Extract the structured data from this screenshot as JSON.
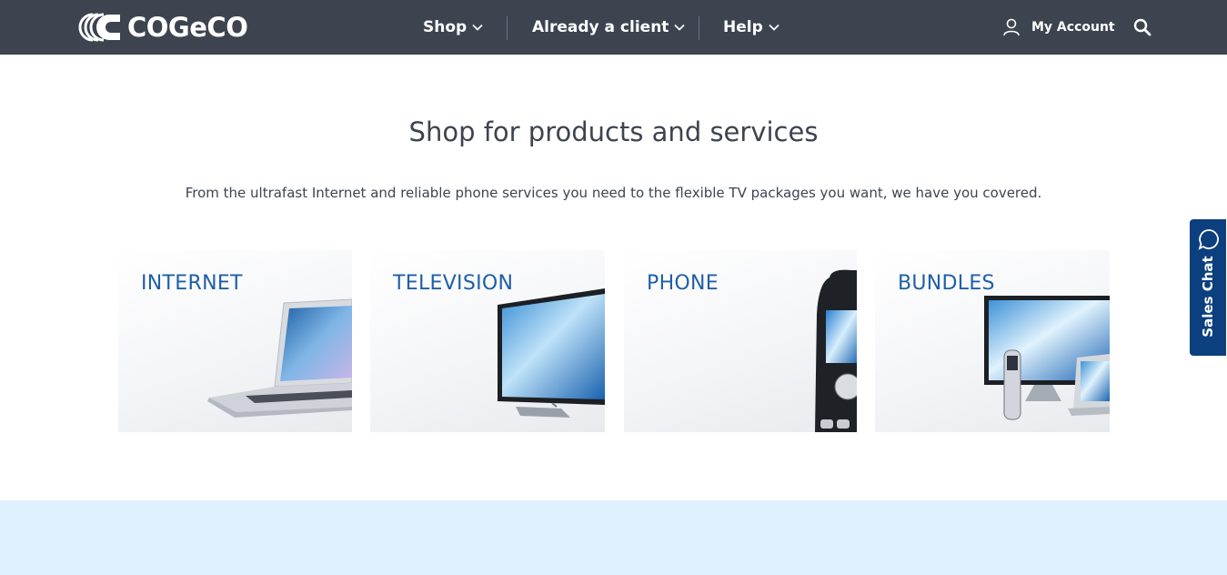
{
  "header": {
    "logo_text": "COGeCO",
    "nav": [
      {
        "label": "Shop"
      },
      {
        "label": "Already a client"
      },
      {
        "label": "Help"
      }
    ],
    "account_label": "My Account",
    "icons": {
      "user": "user-icon",
      "search": "search-icon",
      "chevron": "chevron-down-icon"
    }
  },
  "main": {
    "title": "Shop for products and services",
    "subtitle": "From the ultrafast Internet and reliable phone services you need to the flexible TV packages you want, we have you covered.",
    "cards": [
      {
        "label": "INTERNET"
      },
      {
        "label": "TELEVISION"
      },
      {
        "label": "PHONE"
      },
      {
        "label": "BUNDLES"
      }
    ]
  },
  "chat": {
    "label": "Sales Chat",
    "icon": "chat-bubble-icon"
  },
  "colors": {
    "header_bg": "#3d4450",
    "card_label": "#1f5fa8",
    "chat_bg": "#0b3f7e",
    "band_bg": "#dff1fc"
  }
}
